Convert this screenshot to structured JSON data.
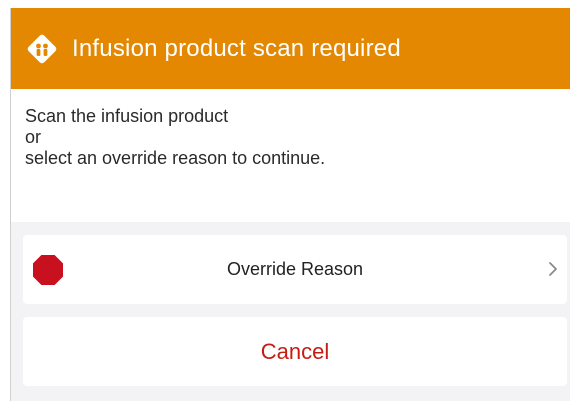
{
  "header": {
    "title": "Infusion product scan required",
    "icon": "warning-diamond-icon",
    "color": "#e38800"
  },
  "message": {
    "line1": "Scan the infusion product",
    "line2": "or",
    "line3": "select an override reason to continue."
  },
  "override_row": {
    "icon": "stop-sign-icon",
    "label": "Override Reason",
    "chevron": "chevron-right-icon"
  },
  "cancel": {
    "label": "Cancel",
    "color": "#c41d12"
  }
}
